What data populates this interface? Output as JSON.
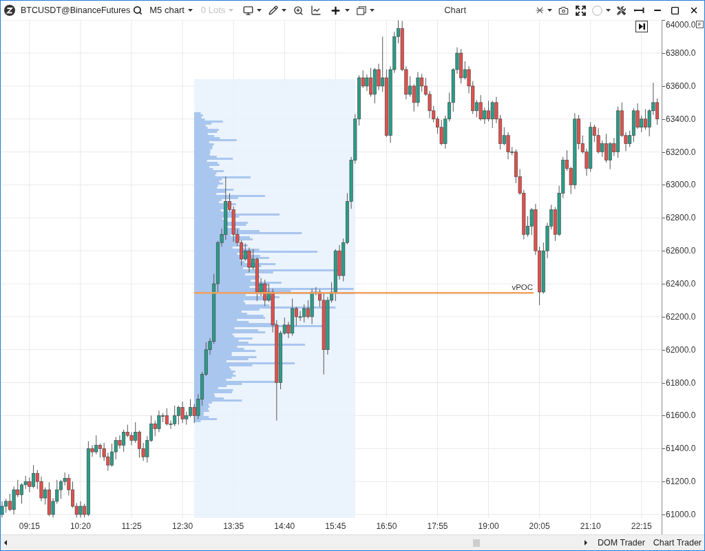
{
  "toolbar": {
    "symbol": "BTCUSDT@BinanceFutures",
    "timeframe": "M5 chart",
    "lots": {
      "label": "0 Lots",
      "disabled": true
    }
  },
  "window": {
    "title": "Chart"
  },
  "chart": {
    "scale_mode": "F",
    "chart_data": {
      "type": "candlestick",
      "x": [
        520,
        525,
        530,
        535,
        540,
        545,
        550,
        555,
        560,
        565,
        570,
        575,
        580,
        585,
        590,
        595,
        600,
        605,
        610,
        615,
        620,
        625,
        630,
        635,
        640,
        645,
        650,
        655,
        660,
        665,
        670,
        675,
        680,
        685,
        690,
        695,
        700,
        705,
        710,
        715,
        720,
        725,
        730,
        735,
        740,
        745,
        750,
        755,
        760,
        765,
        770,
        775,
        780,
        785,
        790,
        795,
        800,
        805,
        810,
        815,
        820,
        825,
        830,
        835,
        840,
        845,
        850,
        855,
        860,
        865,
        870,
        875,
        880,
        885,
        890,
        895,
        900,
        905,
        910,
        915,
        920,
        925,
        930,
        935,
        940,
        945,
        950,
        955,
        960,
        965,
        970,
        975,
        980,
        985,
        990,
        995,
        1000,
        1005,
        1010,
        1015,
        1020,
        1025,
        1030,
        1035,
        1040,
        1045,
        1050,
        1055,
        1060,
        1065,
        1070,
        1075,
        1080,
        1085,
        1090,
        1095,
        1100,
        1105,
        1110,
        1115,
        1120,
        1125,
        1130,
        1135,
        1140,
        1145,
        1150,
        1155,
        1160,
        1165,
        1170,
        1175,
        1180,
        1185,
        1190,
        1195,
        1200,
        1205,
        1210,
        1215,
        1220,
        1225,
        1230,
        1235,
        1240,
        1245,
        1250,
        1255,
        1260,
        1265,
        1270,
        1275,
        1280,
        1285,
        1290,
        1295,
        1300,
        1305,
        1310,
        1315,
        1320,
        1325,
        1330,
        1335,
        1340,
        1345,
        1350,
        1355
      ],
      "ohlc": [
        [
          61000,
          61080,
          60980,
          61050
        ],
        [
          61050,
          61095,
          61010,
          61080
        ],
        [
          61080,
          61125,
          61020,
          61030
        ],
        [
          61030,
          61170,
          61000,
          61150
        ],
        [
          61150,
          61210,
          61105,
          61120
        ],
        [
          61120,
          61190,
          61065,
          61180
        ],
        [
          61180,
          61235,
          61155,
          61200
        ],
        [
          61200,
          61225,
          61135,
          61170
        ],
        [
          61170,
          61300,
          61160,
          61250
        ],
        [
          61250,
          61270,
          61155,
          61200
        ],
        [
          61200,
          61230,
          61080,
          61100
        ],
        [
          61100,
          61165,
          61060,
          61150
        ],
        [
          61150,
          61195,
          60990,
          61000
        ],
        [
          61000,
          61100,
          60980,
          61080
        ],
        [
          61080,
          61210,
          61065,
          61150
        ],
        [
          61150,
          61210,
          61095,
          61200
        ],
        [
          61200,
          61255,
          61175,
          61220
        ],
        [
          61220,
          61245,
          61115,
          61150
        ],
        [
          61150,
          61200,
          61040,
          61050
        ],
        [
          61050,
          61070,
          60980,
          61000
        ],
        [
          61000,
          61080,
          60980,
          61050
        ],
        [
          61050,
          61065,
          60980,
          61000
        ],
        [
          61000,
          61445,
          60990,
          61400
        ],
        [
          61400,
          61420,
          61350,
          61380
        ],
        [
          61380,
          61480,
          61365,
          61420
        ],
        [
          61420,
          61430,
          61345,
          61400
        ],
        [
          61400,
          61435,
          61325,
          61350
        ],
        [
          61350,
          61375,
          61265,
          61300
        ],
        [
          61300,
          61430,
          61290,
          61380
        ],
        [
          61380,
          61470,
          61335,
          61450
        ],
        [
          61450,
          61480,
          61400,
          61420
        ],
        [
          61420,
          61515,
          61380,
          61500
        ],
        [
          61500,
          61545,
          61470,
          61480
        ],
        [
          61480,
          61500,
          61420,
          61450
        ],
        [
          61450,
          61560,
          61435,
          61500
        ],
        [
          61500,
          61510,
          61345,
          61400
        ],
        [
          61400,
          61435,
          61325,
          61350
        ],
        [
          61350,
          61475,
          61315,
          61450
        ],
        [
          61450,
          61600,
          61440,
          61550
        ],
        [
          61550,
          61570,
          61475,
          61520
        ],
        [
          61520,
          61630,
          61500,
          61600
        ],
        [
          61600,
          61615,
          61560,
          61600
        ],
        [
          61600,
          61645,
          61540,
          61550
        ],
        [
          61550,
          61570,
          61520,
          61550
        ],
        [
          61550,
          61660,
          61535,
          61600
        ],
        [
          61600,
          61660,
          61545,
          61650
        ],
        [
          61650,
          61685,
          61555,
          61580
        ],
        [
          61580,
          61625,
          61545,
          61600
        ],
        [
          61600,
          61700,
          61590,
          61650
        ],
        [
          61650,
          61670,
          61555,
          61600
        ],
        [
          61600,
          61730,
          61580,
          61700
        ],
        [
          61700,
          61865,
          61660,
          61850
        ],
        [
          61850,
          62045,
          61840,
          62000
        ],
        [
          62000,
          62070,
          61970,
          62050
        ],
        [
          62050,
          62460,
          62035,
          62400
        ],
        [
          62400,
          62660,
          62345,
          62650
        ],
        [
          62650,
          62735,
          62625,
          62700
        ],
        [
          62700,
          63050,
          62665,
          62900
        ],
        [
          62900,
          62950,
          62840,
          62850
        ],
        [
          62850,
          62870,
          62655,
          62700
        ],
        [
          62700,
          62730,
          62630,
          62650
        ],
        [
          62650,
          62665,
          62510,
          62550
        ],
        [
          62550,
          62645,
          62540,
          62600
        ],
        [
          62600,
          62620,
          62470,
          62500
        ],
        [
          62500,
          62610,
          62485,
          62550
        ],
        [
          62550,
          62560,
          62295,
          62350
        ],
        [
          62350,
          62435,
          62325,
          62400
        ],
        [
          62400,
          62425,
          62265,
          62300
        ],
        [
          62300,
          62400,
          62290,
          62350
        ],
        [
          62350,
          62370,
          62105,
          62150
        ],
        [
          62150,
          62180,
          61570,
          61800
        ],
        [
          61800,
          62115,
          61760,
          62100
        ],
        [
          62100,
          62195,
          62090,
          62150
        ],
        [
          62150,
          62170,
          62070,
          62100
        ],
        [
          62100,
          62310,
          62085,
          62250
        ],
        [
          62250,
          62260,
          62145,
          62200
        ],
        [
          62200,
          62235,
          62175,
          62200
        ],
        [
          62200,
          62275,
          62165,
          62250
        ],
        [
          62250,
          62300,
          62190,
          62200
        ],
        [
          62200,
          62370,
          62155,
          62350
        ],
        [
          62350,
          62380,
          62330,
          62350
        ],
        [
          62350,
          62365,
          62260,
          62300
        ],
        [
          62300,
          62345,
          61850,
          62000
        ],
        [
          62000,
          62320,
          61970,
          62300
        ],
        [
          62300,
          62410,
          62285,
          62350
        ],
        [
          62350,
          62610,
          62295,
          62600
        ],
        [
          62600,
          62635,
          62425,
          62450
        ],
        [
          62450,
          62675,
          62415,
          62650
        ],
        [
          62650,
          62950,
          62640,
          62900
        ],
        [
          62900,
          63170,
          62855,
          63150
        ],
        [
          63150,
          63430,
          63130,
          63400
        ],
        [
          63400,
          63665,
          63360,
          63650
        ],
        [
          63650,
          63695,
          63590,
          63600
        ],
        [
          63600,
          63670,
          63570,
          63650
        ],
        [
          63650,
          63710,
          63535,
          63550
        ],
        [
          63550,
          63710,
          63495,
          63700
        ],
        [
          63700,
          63735,
          63575,
          63600
        ],
        [
          63600,
          63900,
          63565,
          63650
        ],
        [
          63650,
          63700,
          63290,
          63300
        ],
        [
          63300,
          63720,
          63255,
          63700
        ],
        [
          63700,
          63930,
          63680,
          63900
        ],
        [
          63900,
          64000,
          63860,
          63950
        ],
        [
          63950,
          63995,
          63690,
          63700
        ],
        [
          63700,
          63720,
          63520,
          63550
        ],
        [
          63550,
          63660,
          63535,
          63600
        ],
        [
          63600,
          63610,
          63445,
          63500
        ],
        [
          63500,
          63685,
          63475,
          63650
        ],
        [
          63650,
          63675,
          63565,
          63600
        ],
        [
          63600,
          63650,
          63540,
          63550
        ],
        [
          63550,
          63570,
          63405,
          63450
        ],
        [
          63450,
          63480,
          63380,
          63400
        ],
        [
          63400,
          63415,
          63310,
          63350
        ],
        [
          63350,
          63395,
          63240,
          63250
        ],
        [
          63250,
          63420,
          63220,
          63400
        ],
        [
          63400,
          63560,
          63385,
          63500
        ],
        [
          63500,
          63710,
          63445,
          63700
        ],
        [
          63700,
          63835,
          63675,
          63800
        ],
        [
          63800,
          63825,
          63615,
          63650
        ],
        [
          63650,
          63750,
          63640,
          63700
        ],
        [
          63700,
          63720,
          63555,
          63600
        ],
        [
          63600,
          63630,
          63430,
          63450
        ],
        [
          63450,
          63515,
          63410,
          63500
        ],
        [
          63500,
          63545,
          63390,
          63400
        ],
        [
          63400,
          63470,
          63370,
          63450
        ],
        [
          63450,
          63510,
          63385,
          63400
        ],
        [
          63400,
          63510,
          63345,
          63500
        ],
        [
          63500,
          63535,
          63375,
          63400
        ],
        [
          63400,
          63425,
          63215,
          63250
        ],
        [
          63250,
          63350,
          63240,
          63300
        ],
        [
          63300,
          63320,
          63155,
          63200
        ],
        [
          63200,
          63230,
          63180,
          63200
        ],
        [
          63200,
          63215,
          63010,
          63050
        ],
        [
          63050,
          63095,
          62940,
          62950
        ],
        [
          62950,
          62970,
          62670,
          62700
        ],
        [
          62700,
          62810,
          62685,
          62750
        ],
        [
          62750,
          62860,
          62695,
          62850
        ],
        [
          62850,
          62885,
          62575,
          62600
        ],
        [
          62600,
          62625,
          62270,
          62350
        ],
        [
          62350,
          62650,
          62340,
          62600
        ],
        [
          62600,
          62770,
          62555,
          62750
        ],
        [
          62750,
          62880,
          62730,
          62850
        ],
        [
          62850,
          62865,
          62660,
          62700
        ],
        [
          62700,
          62995,
          62690,
          62950
        ],
        [
          62950,
          63170,
          62920,
          63150
        ],
        [
          63150,
          63210,
          63085,
          63100
        ],
        [
          63100,
          63110,
          62945,
          63000
        ],
        [
          63000,
          63435,
          62975,
          63400
        ],
        [
          63400,
          63425,
          63215,
          63250
        ],
        [
          63250,
          63300,
          63190,
          63200
        ],
        [
          63200,
          63220,
          63055,
          63100
        ],
        [
          63100,
          63380,
          63080,
          63350
        ],
        [
          63350,
          63365,
          63260,
          63300
        ],
        [
          63300,
          63345,
          63190,
          63200
        ],
        [
          63200,
          63270,
          63170,
          63250
        ],
        [
          63250,
          63310,
          63135,
          63150
        ],
        [
          63150,
          63260,
          63095,
          63250
        ],
        [
          63250,
          63285,
          63175,
          63200
        ],
        [
          63200,
          63475,
          63165,
          63450
        ],
        [
          63450,
          63500,
          63290,
          63300
        ],
        [
          63300,
          63320,
          63205,
          63250
        ],
        [
          63250,
          63330,
          63230,
          63300
        ],
        [
          63300,
          63465,
          63260,
          63450
        ],
        [
          63450,
          63495,
          63340,
          63350
        ],
        [
          63350,
          63420,
          63320,
          63400
        ],
        [
          63400,
          63460,
          63335,
          63350
        ],
        [
          63350,
          63460,
          63295,
          63450
        ],
        [
          63450,
          63620,
          63425,
          63500
        ],
        [
          63500,
          63525,
          63365,
          63400
        ]
      ],
      "xlim": [
        518.25,
        1360.65
      ],
      "ylim": [
        60979,
        64001
      ],
      "xticks": [
        {
          "value": 555,
          "label": "09:15"
        },
        {
          "value": 620,
          "label": "10:20"
        },
        {
          "value": 685,
          "label": "11:25"
        },
        {
          "value": 750,
          "label": "12:30"
        },
        {
          "value": 815,
          "label": "13:35"
        },
        {
          "value": 880,
          "label": "14:40"
        },
        {
          "value": 945,
          "label": "15:45"
        },
        {
          "value": 1010,
          "label": "16:50"
        },
        {
          "value": 1075,
          "label": "17:55"
        },
        {
          "value": 1140,
          "label": "19:00"
        },
        {
          "value": 1205,
          "label": "20:05"
        },
        {
          "value": 1270,
          "label": "21:10"
        },
        {
          "value": 1335,
          "label": "22:15"
        }
      ],
      "yticks": [
        {
          "value": 64000,
          "label": "64000.0"
        },
        {
          "value": 63800,
          "label": "63800.0"
        },
        {
          "value": 63600,
          "label": "63600.0"
        },
        {
          "value": 63400,
          "label": "63400.0"
        },
        {
          "value": 63200,
          "label": "63200.0"
        },
        {
          "value": 63000,
          "label": "63000.0"
        },
        {
          "value": 62800,
          "label": "62800.0"
        },
        {
          "value": 62600,
          "label": "62600.0"
        },
        {
          "value": 62400,
          "label": "62400.0"
        },
        {
          "value": 62200,
          "label": "62200.0"
        },
        {
          "value": 62000,
          "label": "62000.0"
        },
        {
          "value": 61800,
          "label": "61800.0"
        },
        {
          "value": 61600,
          "label": "61600.0"
        },
        {
          "value": 61400,
          "label": "61400.0"
        },
        {
          "value": 61200,
          "label": "61200.0"
        },
        {
          "value": 61000,
          "label": "61000.0"
        }
      ],
      "grid": true,
      "ref_lines": [
        {
          "axis": "y",
          "value": 62345,
          "label": "vPOC"
        }
      ]
    }
  },
  "bottom_bar": {
    "buttons": [
      "DOM Trader",
      "Chart Trader"
    ]
  }
}
